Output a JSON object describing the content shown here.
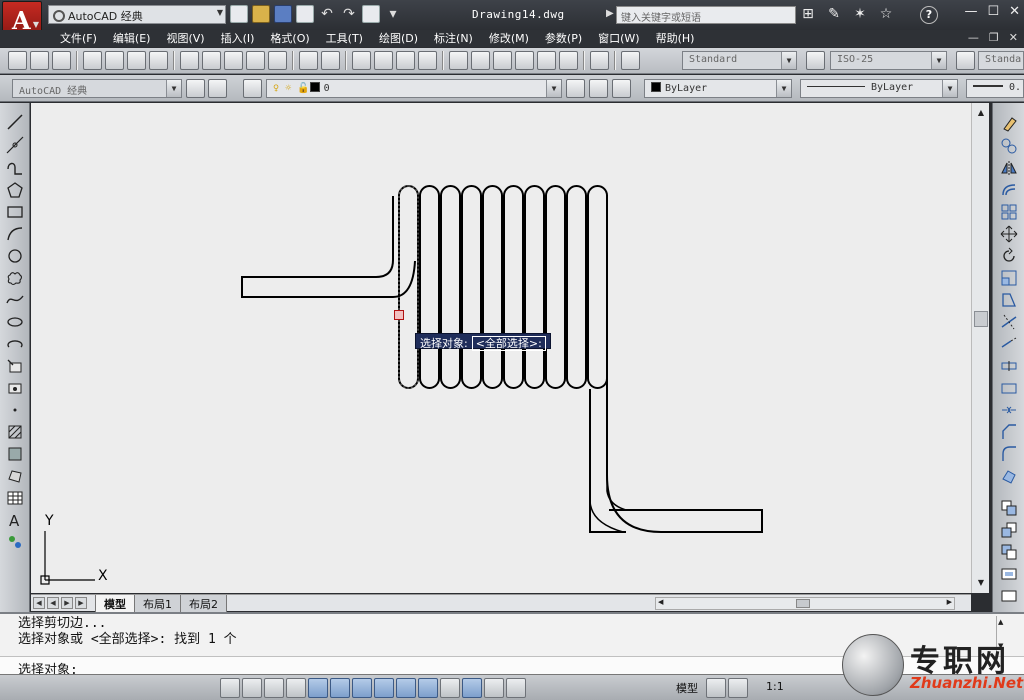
{
  "titlebar": {
    "workspace": "AutoCAD 经典",
    "document_title": "Drawing14.dwg",
    "search_placeholder": "键入关键字或短语"
  },
  "menu": {
    "items": [
      "文件(F)",
      "编辑(E)",
      "视图(V)",
      "插入(I)",
      "格式(O)",
      "工具(T)",
      "绘图(D)",
      "标注(N)",
      "修改(M)",
      "参数(P)",
      "窗口(W)",
      "帮助(H)"
    ]
  },
  "styles_toolbar": {
    "text_style": "Standard",
    "dim_style": "ISO-25",
    "table_style": "Standa"
  },
  "layers_toolbar": {
    "workspace_combo": "AutoCAD 经典",
    "layer_name": "0",
    "color": "ByLayer",
    "linetype": "ByLayer",
    "lineweight": "0."
  },
  "canvas": {
    "tooltip_prompt": "选择对象:",
    "tooltip_option": "<全部选择>:",
    "ucs_y_label": "Y",
    "ucs_x_label": "X"
  },
  "tabs": [
    "模型",
    "布局1",
    "布局2"
  ],
  "command": {
    "history": [
      "选择剪切边...",
      "选择对象或 <全部选择>:  找到 1 个"
    ],
    "prompt": "选择对象:"
  },
  "statusbar": {
    "model": "模型",
    "scale": "1:1"
  },
  "watermark": {
    "text": "专职网",
    "url": "Zhuanzhi.Net"
  }
}
